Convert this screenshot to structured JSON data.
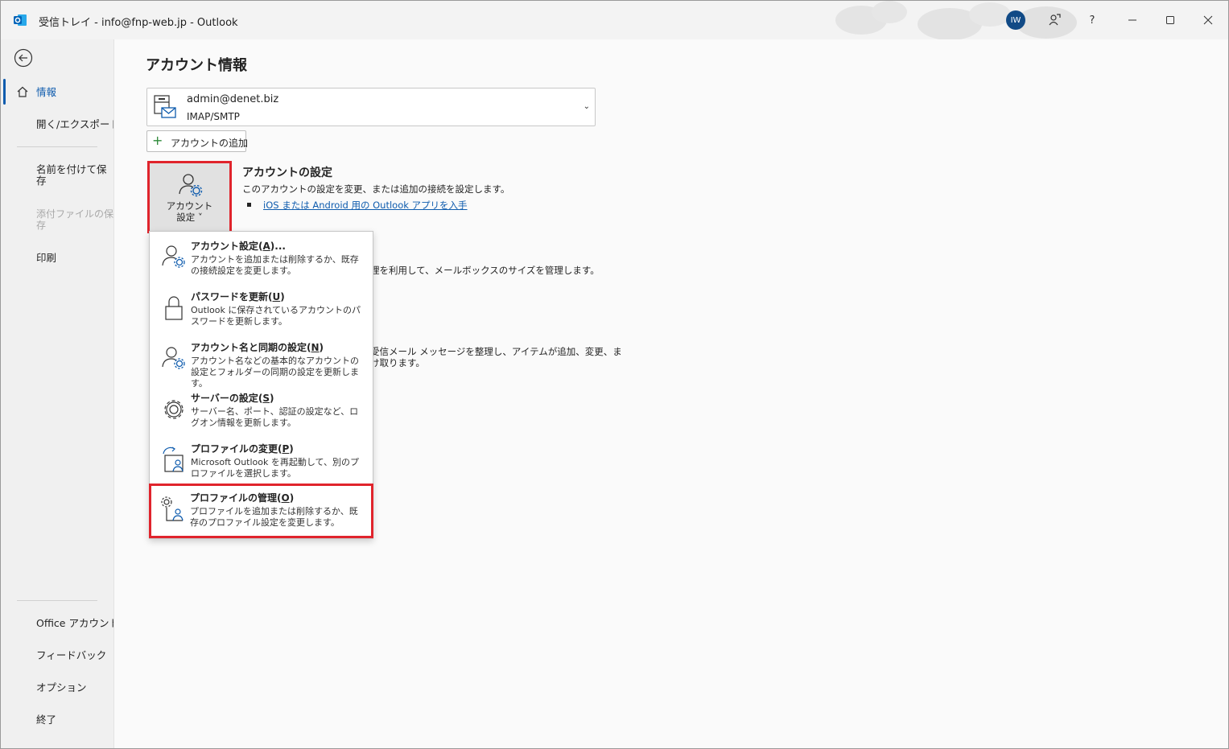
{
  "window": {
    "title": "受信トレイ - info@fnp-web.jp  -  Outlook",
    "avatar_initials": "IW",
    "help_label": "?"
  },
  "nav": {
    "items": [
      {
        "label": "情報"
      },
      {
        "label": "開く/エクスポート"
      },
      {
        "label": "名前を付けて保\n存"
      },
      {
        "label": "添付ファイルの保\n存"
      },
      {
        "label": "印刷"
      },
      {
        "label": "Office アカウント"
      },
      {
        "label": "フィードバック"
      },
      {
        "label": "オプション"
      },
      {
        "label": "終了"
      }
    ]
  },
  "main": {
    "page_title": "アカウント情報",
    "account": {
      "email": "admin@denet.biz",
      "type": "IMAP/SMTP"
    },
    "add_account_label": "アカウントの追加",
    "account_settings_button": "アカウント\n設定 ˅",
    "section": {
      "title": "アカウントの設定",
      "desc": "このアカウントの設定を変更、または追加の接続を設定します。",
      "link": "iOS または Android 用の Outlook アプリを入手"
    },
    "bg_text_1": "理を利用して、メールボックスのサイズを管理します。",
    "bg_text_2": "受信メール メッセージを整理し、アイテムが追加、変更、ま",
    "bg_text_3": "け取ります。"
  },
  "dropdown": {
    "items": [
      {
        "title": "アカウント設定(",
        "key": "A",
        "suffix": ")...",
        "desc": "アカウントを追加または削除するか、既存の接続設定を変更します。"
      },
      {
        "title": "パスワードを更新(",
        "key": "U",
        "suffix": ")",
        "desc": "Outlook に保存されているアカウントのパスワードを更新します。"
      },
      {
        "title": "アカウント名と同期の設定(",
        "key": "N",
        "suffix": ")",
        "desc": "アカウント名などの基本的なアカウントの設定とフォルダーの同期の設定を更新します。"
      },
      {
        "title": "サーバーの設定(",
        "key": "S",
        "suffix": ")",
        "desc": "サーバー名、ポート、認証の設定など、ログオン情報を更新します。"
      },
      {
        "title": "プロファイルの変更(",
        "key": "P",
        "suffix": ")",
        "desc": "Microsoft Outlook を再起動して、別のプロファイルを選択します。"
      },
      {
        "title": "プロファイルの管理(",
        "key": "O",
        "suffix": ")",
        "desc": "プロファイルを追加または削除するか、既存のプロファイル設定を変更します。"
      }
    ]
  },
  "colors": {
    "accent": "#0f5cae",
    "highlight_red": "#e0242c",
    "add_green": "#2d8a3a"
  }
}
